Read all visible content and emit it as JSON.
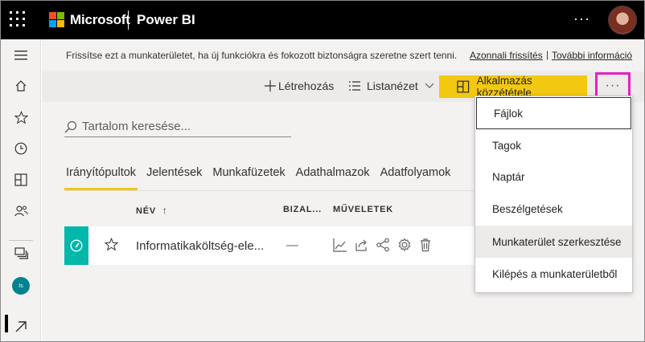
{
  "topbar": {
    "brand": "Microsoft",
    "product": "Power BI",
    "more": "···"
  },
  "notice": {
    "text": "Frissítse ezt a munkaterületet, ha új funkciókra és fokozott biztonságra szeretne szert tenni.",
    "link_refresh": "Azonnali frissítés",
    "separator": "|",
    "link_more": "További információ"
  },
  "cmdbar": {
    "create_label": "Létrehozás",
    "view_label": "Listanézet",
    "publish_label": "Alkalmazás közzététele",
    "more": "···"
  },
  "search": {
    "placeholder": "Tartalom keresése..."
  },
  "tabs": [
    {
      "label": "Irányítópultok",
      "active": true
    },
    {
      "label": "Jelentések"
    },
    {
      "label": "Munkafüzetek"
    },
    {
      "label": "Adathalmazok"
    },
    {
      "label": "Adatfolyamok"
    }
  ],
  "table": {
    "columns": {
      "name": "NÉV",
      "sort_arrow": "↑",
      "sensitivity": "BIZAL...",
      "actions": "MŰVELETEK"
    },
    "rows": [
      {
        "name": "Informatikaköltség-ele...",
        "sensitivity": "—"
      }
    ]
  },
  "nav": {
    "workspace_initials": "Is"
  },
  "menu": {
    "items": [
      "Fájlok",
      "Tagok",
      "Naptár",
      "Beszélgetések",
      "Munkaterület szerkesztése",
      "Kilépés a munkaterületből"
    ]
  },
  "colors": {
    "accent_yellow": "#F2C811",
    "highlight_magenta": "#E61EC6",
    "dashboard_teal": "#01B8AA"
  }
}
